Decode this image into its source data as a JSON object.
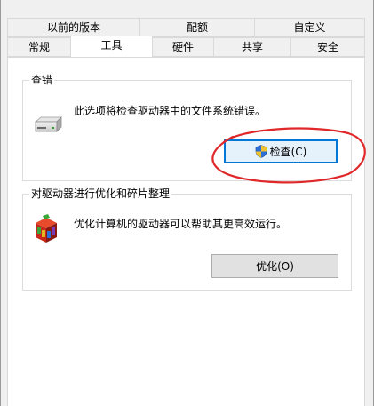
{
  "tabs": {
    "row1": [
      "以前的版本",
      "配额",
      "自定义"
    ],
    "row2": [
      "常规",
      "工具",
      "硬件",
      "共享",
      "安全"
    ],
    "active": "工具"
  },
  "error_check": {
    "title": "查错",
    "description": "此选项将检查驱动器中的文件系统错误。",
    "button_label": "检查(C)",
    "icon": "drive-icon",
    "button_icon": "uac-shield-icon"
  },
  "optimize": {
    "title": "对驱动器进行优化和碎片整理",
    "description": "优化计算机的驱动器可以帮助其更高效运行。",
    "button_label": "优化(O)",
    "icon": "defrag-icon"
  },
  "colors": {
    "accent": "#0078d7",
    "annotation": "#e0282a"
  }
}
